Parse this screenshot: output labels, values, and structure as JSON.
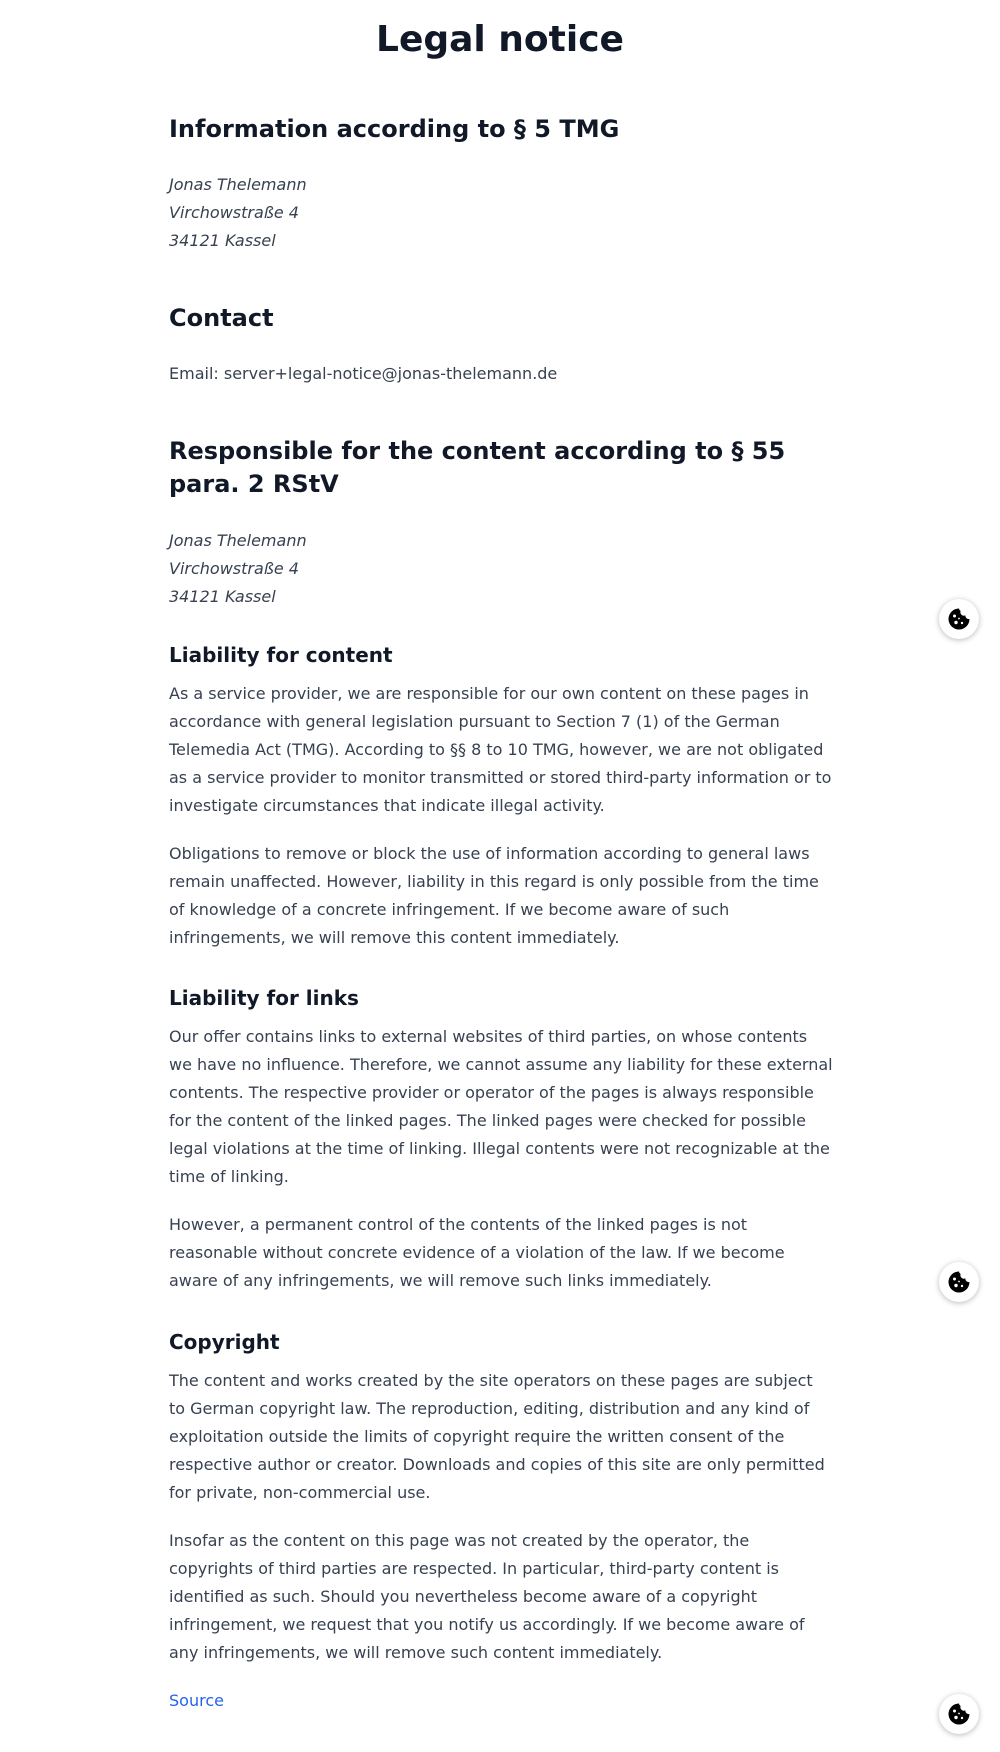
{
  "page": {
    "title": "Legal notice"
  },
  "sections": {
    "info": {
      "heading": "Information according to § 5 TMG",
      "address": [
        "Jonas Thelemann",
        "Virchowstraße 4",
        "34121 Kassel"
      ]
    },
    "contact": {
      "heading": "Contact",
      "email": "Email: server+legal-notice@jonas-thelemann.de"
    },
    "responsible": {
      "heading": "Responsible for the content according to § 55 para. 2 RStV",
      "address": [
        "Jonas Thelemann",
        "Virchowstraße 4",
        "34121 Kassel"
      ]
    },
    "liability_content": {
      "heading": "Liability for content",
      "p1": "As a service provider, we are responsible for our own content on these pages in accordance with general legislation pursuant to Section 7 (1) of the German Telemedia Act (TMG). According to §§ 8 to 10 TMG, however, we are not obligated as a service provider to monitor transmitted or stored third-party information or to investigate circumstances that indicate illegal activity.",
      "p2": "Obligations to remove or block the use of information according to general laws remain unaffected. However, liability in this regard is only possible from the time of knowledge of a concrete infringement. If we become aware of such infringements, we will remove this content immediately."
    },
    "liability_links": {
      "heading": "Liability for links",
      "p1": "Our offer contains links to external websites of third parties, on whose contents we have no influence. Therefore, we cannot assume any liability for these external contents. The respective provider or operator of the pages is always responsible for the content of the linked pages. The linked pages were checked for possible legal violations at the time of linking. Illegal contents were not recognizable at the time of linking.",
      "p2": "However, a permanent control of the contents of the linked pages is not reasonable without concrete evidence of a violation of the law. If we become aware of any infringements, we will remove such links immediately."
    },
    "copyright": {
      "heading": "Copyright",
      "p1": "The content and works created by the site operators on these pages are subject to German copyright law. The reproduction, editing, distribution and any kind of exploitation outside the limits of copyright require the written consent of the respective author or creator. Downloads and copies of this site are only permitted for private, non-commercial use.",
      "p2": "Insofar as the content on this page was not created by the operator, the copyrights of third parties are respected. In particular, third-party content is identified as such. Should you nevertheless become aware of a copyright infringement, we request that you notify us accordingly. If we become aware of any infringements, we will remove such content immediately."
    }
  },
  "source_link": {
    "label": "Source"
  },
  "cookie_buttons": {
    "icon": "cookie-icon",
    "count": 3
  },
  "colors": {
    "heading": "#111827",
    "body": "#374151",
    "link": "#2563eb"
  }
}
